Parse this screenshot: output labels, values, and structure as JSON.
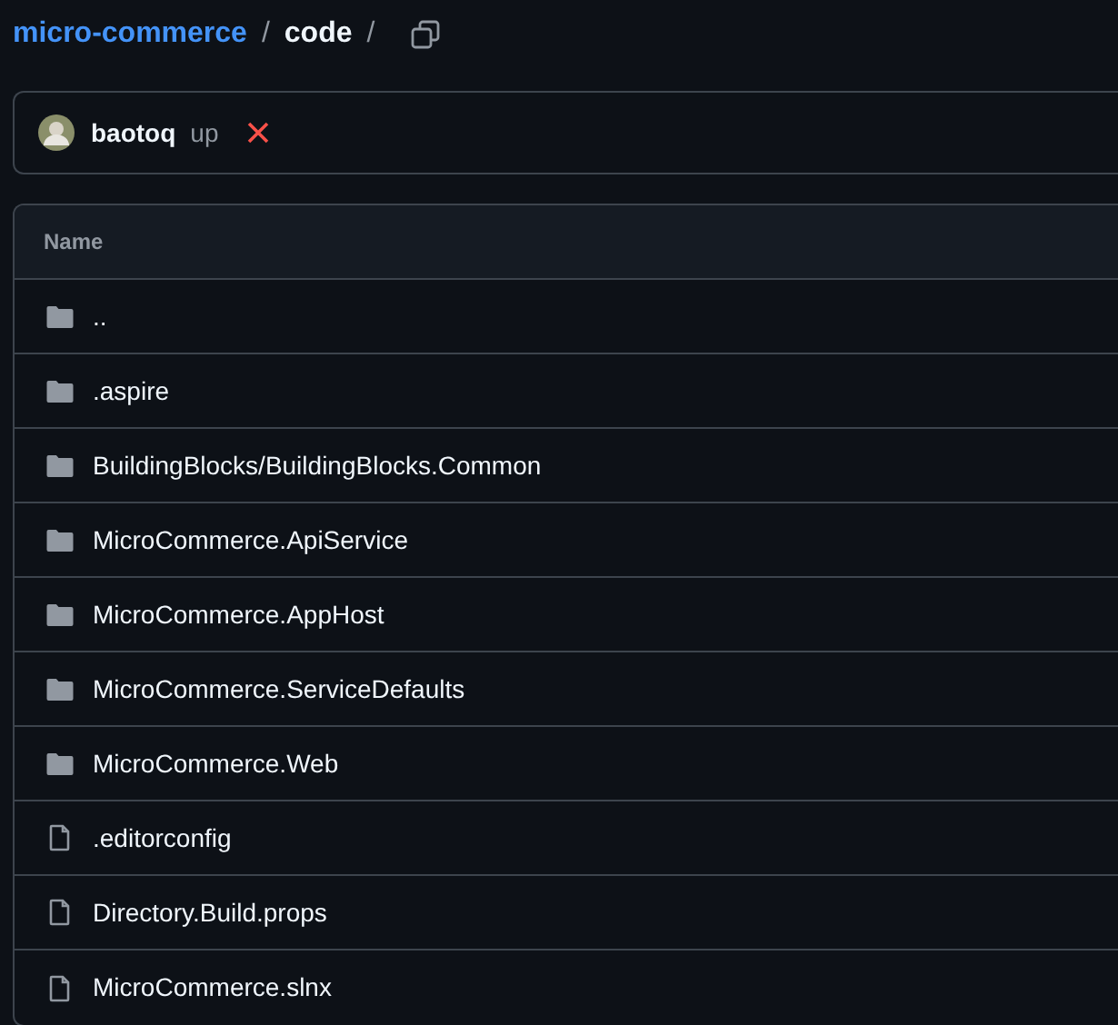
{
  "breadcrumb": [
    {
      "text": "micro-commerce",
      "kind": "link"
    },
    {
      "text": "/",
      "kind": "separator"
    },
    {
      "text": "code",
      "kind": "current"
    },
    {
      "text": "/",
      "kind": "separator"
    }
  ],
  "commit": {
    "author": "baotoq",
    "message": "up",
    "checks_failed": true
  },
  "table": {
    "columns": [
      "Name"
    ],
    "rows": [
      {
        "name": "..",
        "kind": "folder"
      },
      {
        "name": ".aspire",
        "kind": "folder"
      },
      {
        "name": "BuildingBlocks/BuildingBlocks.Common",
        "kind": "folder"
      },
      {
        "name": "MicroCommerce.ApiService",
        "kind": "folder"
      },
      {
        "name": "MicroCommerce.AppHost",
        "kind": "folder"
      },
      {
        "name": "MicroCommerce.ServiceDefaults",
        "kind": "folder"
      },
      {
        "name": "MicroCommerce.Web",
        "kind": "folder"
      },
      {
        "name": ".editorconfig",
        "kind": "file"
      },
      {
        "name": "Directory.Build.props",
        "kind": "file"
      },
      {
        "name": "MicroCommerce.slnx",
        "kind": "file"
      }
    ]
  }
}
